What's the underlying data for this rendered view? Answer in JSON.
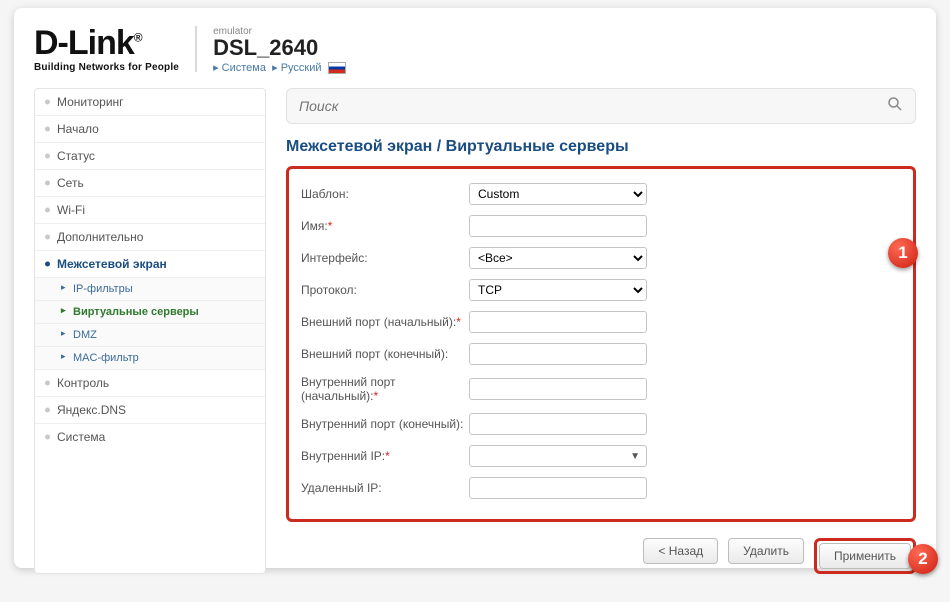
{
  "brand": {
    "logo": "D-Link",
    "tagline": "Building Networks for People"
  },
  "model": {
    "emulator_label": "emulator",
    "name": "DSL_2640",
    "link1": "Система",
    "link2": "Русский"
  },
  "search": {
    "placeholder": "Поиск"
  },
  "sidebar": {
    "items": [
      "Мониторинг",
      "Начало",
      "Статус",
      "Сеть",
      "Wi-Fi",
      "Дополнительно",
      "Межсетевой экран",
      "Контроль",
      "Яндекс.DNS",
      "Система"
    ],
    "sub": [
      "IP-фильтры",
      "Виртуальные серверы",
      "DMZ",
      "MAC-фильтр"
    ]
  },
  "title": "Межсетевой экран /  Виртуальные серверы",
  "form": {
    "template_label": "Шаблон:",
    "template_value": "Custom",
    "name_label": "Имя:",
    "interface_label": "Интерфейс:",
    "interface_value": "<Все>",
    "protocol_label": "Протокол:",
    "protocol_value": "TCP",
    "ext_port_start_label": "Внешний порт (начальный):",
    "ext_port_end_label": "Внешний порт (конечный):",
    "int_port_start_label": "Внутренний порт (начальный):",
    "int_port_end_label": "Внутренний порт (конечный):",
    "int_ip_label": "Внутренний IP:",
    "remote_ip_label": "Удаленный IP:"
  },
  "buttons": {
    "back": "< Назад",
    "delete": "Удалить",
    "apply": "Применить"
  },
  "annotations": {
    "one": "1",
    "two": "2"
  }
}
